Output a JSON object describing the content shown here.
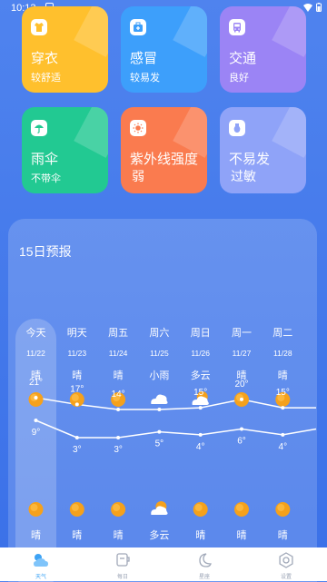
{
  "status_bar": {
    "time": "10:13"
  },
  "tiles": [
    {
      "title": "穿衣",
      "sub": "较舒适",
      "icon": "shirt-icon",
      "color": "#ffc02d"
    },
    {
      "title": "感冒",
      "sub": "较易发",
      "icon": "medkit-icon",
      "color": "#3d9ffb"
    },
    {
      "title": "交通",
      "sub": "良好",
      "icon": "bus-icon",
      "color": "#9b84f5"
    },
    {
      "title": "雨伞",
      "sub": "不带伞",
      "icon": "umbrella-icon",
      "color": "#22c992"
    },
    {
      "title": "紫外线强度",
      "sub": "弱",
      "icon": "sun-icon",
      "color": "#fa7b4f"
    },
    {
      "title": "不易发",
      "sub": "过敏",
      "icon": "allergy-icon",
      "color": "#8fa3f8"
    }
  ],
  "forecast": {
    "title": "15日预报",
    "days": [
      {
        "name": "今天",
        "date": "11/22",
        "day_weather": "晴",
        "day_icon": "sun",
        "night_icon": "sun",
        "night_weather": "晴"
      },
      {
        "name": "明天",
        "date": "11/23",
        "day_weather": "晴",
        "day_icon": "sun",
        "night_icon": "sun",
        "night_weather": "晴"
      },
      {
        "name": "周五",
        "date": "11/24",
        "day_weather": "晴",
        "day_icon": "sun",
        "night_icon": "sun",
        "night_weather": "晴"
      },
      {
        "name": "周六",
        "date": "11/25",
        "day_weather": "小雨",
        "day_icon": "cloud",
        "night_icon": "partly-cloudy",
        "night_weather": "多云"
      },
      {
        "name": "周日",
        "date": "11/26",
        "day_weather": "多云",
        "day_icon": "partly-cloudy",
        "night_icon": "sun",
        "night_weather": "晴"
      },
      {
        "name": "周一",
        "date": "11/27",
        "day_weather": "晴",
        "day_icon": "sun",
        "night_icon": "sun",
        "night_weather": "晴"
      },
      {
        "name": "周二",
        "date": "11/28",
        "day_weather": "晴",
        "day_icon": "sun",
        "night_icon": "sun",
        "night_weather": "晴"
      }
    ]
  },
  "chart_data": {
    "type": "line",
    "categories": [
      "11/22",
      "11/23",
      "11/24",
      "11/25",
      "11/26",
      "11/27",
      "11/28"
    ],
    "series": [
      {
        "values": [
          21,
          17,
          14,
          14,
          15,
          20,
          15
        ],
        "labels": [
          "21°",
          "17°",
          "14°",
          "",
          "15°",
          "20°",
          "15°"
        ]
      },
      {
        "values": [
          9,
          3,
          3,
          5,
          4,
          6,
          4
        ],
        "labels": [
          "9°",
          "3°",
          "3°",
          "5°",
          "4°",
          "6°",
          "4°"
        ]
      }
    ],
    "colors": {
      "line": "#ffffff",
      "sun": "#f5a11c"
    }
  },
  "bottom_nav": [
    {
      "label": "天气",
      "icon": "weather-icon",
      "active": true
    },
    {
      "label": "每日",
      "icon": "cup-icon",
      "active": false
    },
    {
      "label": "星座",
      "icon": "moon-icon",
      "active": false
    },
    {
      "label": "设置",
      "icon": "settings-icon",
      "active": false
    }
  ]
}
